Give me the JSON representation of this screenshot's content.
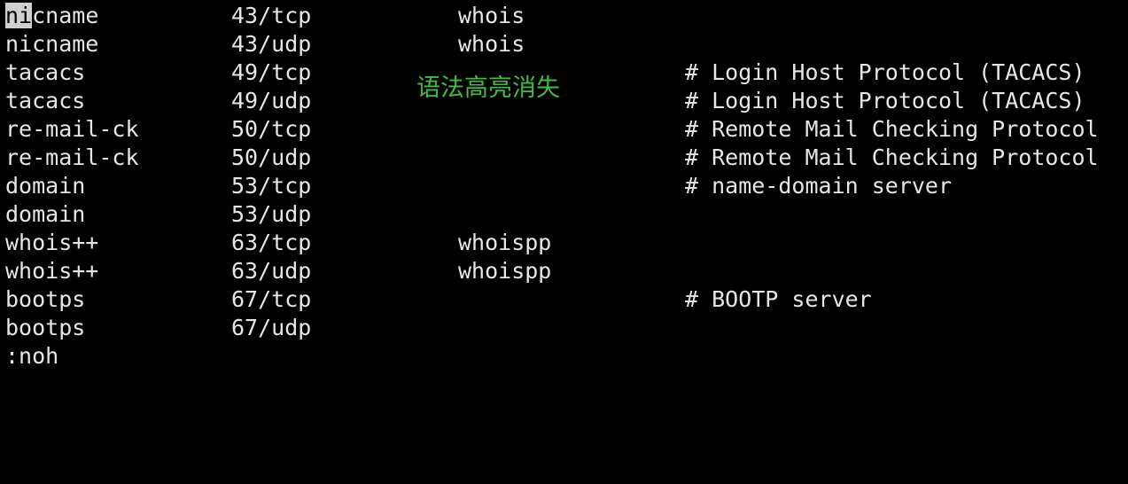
{
  "terminal": {
    "lines": [
      {
        "service": "nicname",
        "port": "43/tcp",
        "alias": "whois",
        "comment": ""
      },
      {
        "service": "nicname",
        "port": "43/udp",
        "alias": "whois",
        "comment": ""
      },
      {
        "service": "tacacs",
        "port": "49/tcp",
        "alias": "",
        "comment": "# Login Host Protocol (TACACS)"
      },
      {
        "service": "tacacs",
        "port": "49/udp",
        "alias": "",
        "comment": "# Login Host Protocol (TACACS)"
      },
      {
        "service": "re-mail-ck",
        "port": "50/tcp",
        "alias": "",
        "comment": "# Remote Mail Checking Protocol"
      },
      {
        "service": "re-mail-ck",
        "port": "50/udp",
        "alias": "",
        "comment": "# Remote Mail Checking Protocol"
      },
      {
        "service": "domain",
        "port": "53/tcp",
        "alias": "",
        "comment": "# name-domain server"
      },
      {
        "service": "domain",
        "port": "53/udp",
        "alias": "",
        "comment": ""
      },
      {
        "service": "whois++",
        "port": "63/tcp",
        "alias": "whoispp",
        "comment": ""
      },
      {
        "service": "whois++",
        "port": "63/udp",
        "alias": "whoispp",
        "comment": ""
      },
      {
        "service": "bootps",
        "port": "67/tcp",
        "alias": "",
        "comment": "# BOOTP server"
      },
      {
        "service": "bootps",
        "port": "67/udp",
        "alias": "",
        "comment": ""
      }
    ],
    "cursor_text": "ni",
    "first_service_rest": "cname",
    "command_line": ":noh"
  },
  "annotation": {
    "text": "语法高亮消失",
    "color": "#3fbf3f"
  },
  "colors": {
    "background": "#000000",
    "foreground": "#e6e6e6",
    "cursor": "#cfcfcf"
  }
}
